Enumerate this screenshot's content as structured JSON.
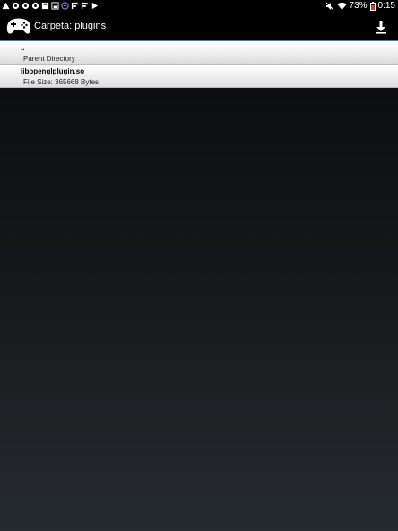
{
  "status_bar": {
    "battery": "73%",
    "time": "0:15"
  },
  "action_bar": {
    "title": "Carpeta: plugins",
    "app_icon": "gamepad-icon",
    "action_icon": "download-icon"
  },
  "files": [
    {
      "name": "..",
      "detail": "Parent Directory"
    },
    {
      "name": "libopenglplugin.so",
      "detail": "File Size: 365668 Bytes"
    }
  ]
}
